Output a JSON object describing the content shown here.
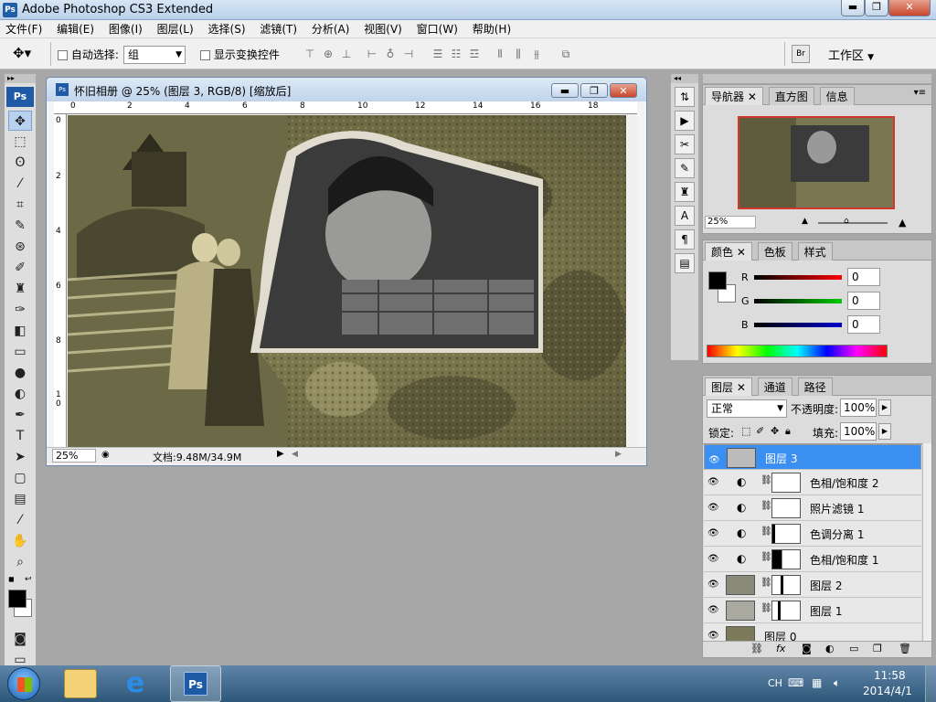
{
  "app": {
    "title": "Adobe Photoshop CS3 Extended",
    "icon": "Ps"
  },
  "menubar": [
    "文件(F)",
    "编辑(E)",
    "图像(I)",
    "图层(L)",
    "选择(S)",
    "滤镜(T)",
    "分析(A)",
    "视图(V)",
    "窗口(W)",
    "帮助(H)"
  ],
  "options": {
    "auto_select_label": "自动选择:",
    "auto_select_value": "组",
    "show_transform_label": "显示变换控件",
    "workspace_label": "工作区"
  },
  "document": {
    "title": "怀旧相册 @ 25% (图层 3, RGB/8) [缩放后]",
    "zoom": "25%",
    "doc_info": "文档:9.48M/34.9M",
    "ruler_top": [
      "0",
      "2",
      "4",
      "6",
      "8",
      "10",
      "12",
      "14",
      "16",
      "18"
    ],
    "ruler_left": [
      "0",
      "2",
      "4",
      "6",
      "8",
      "1\n0"
    ]
  },
  "navigator": {
    "tabs": [
      "导航器",
      "直方图",
      "信息"
    ],
    "zoom": "25%"
  },
  "color_panel": {
    "tabs": [
      "颜色",
      "色板",
      "样式"
    ],
    "r_label": "R",
    "r_value": "0",
    "g_label": "G",
    "g_value": "0",
    "b_label": "B",
    "b_value": "0"
  },
  "layers_panel": {
    "tabs": [
      "图层",
      "通道",
      "路径"
    ],
    "blend_mode": "正常",
    "opacity_label": "不透明度:",
    "opacity": "100%",
    "lock_label": "锁定:",
    "fill_label": "填充:",
    "fill": "100%",
    "layers": [
      {
        "name": "图层 3",
        "selected": true
      },
      {
        "name": "色相/饱和度 2",
        "selected": false
      },
      {
        "name": "照片滤镜 1",
        "selected": false
      },
      {
        "name": "色调分离 1",
        "selected": false
      },
      {
        "name": "色相/饱和度 1",
        "selected": false
      },
      {
        "name": "图层 2",
        "selected": false
      },
      {
        "name": "图层 1",
        "selected": false
      },
      {
        "name": "图层 0",
        "selected": false
      }
    ]
  },
  "taskbar": {
    "lang": "CH",
    "time": "11:58",
    "date": "2014/4/1"
  }
}
